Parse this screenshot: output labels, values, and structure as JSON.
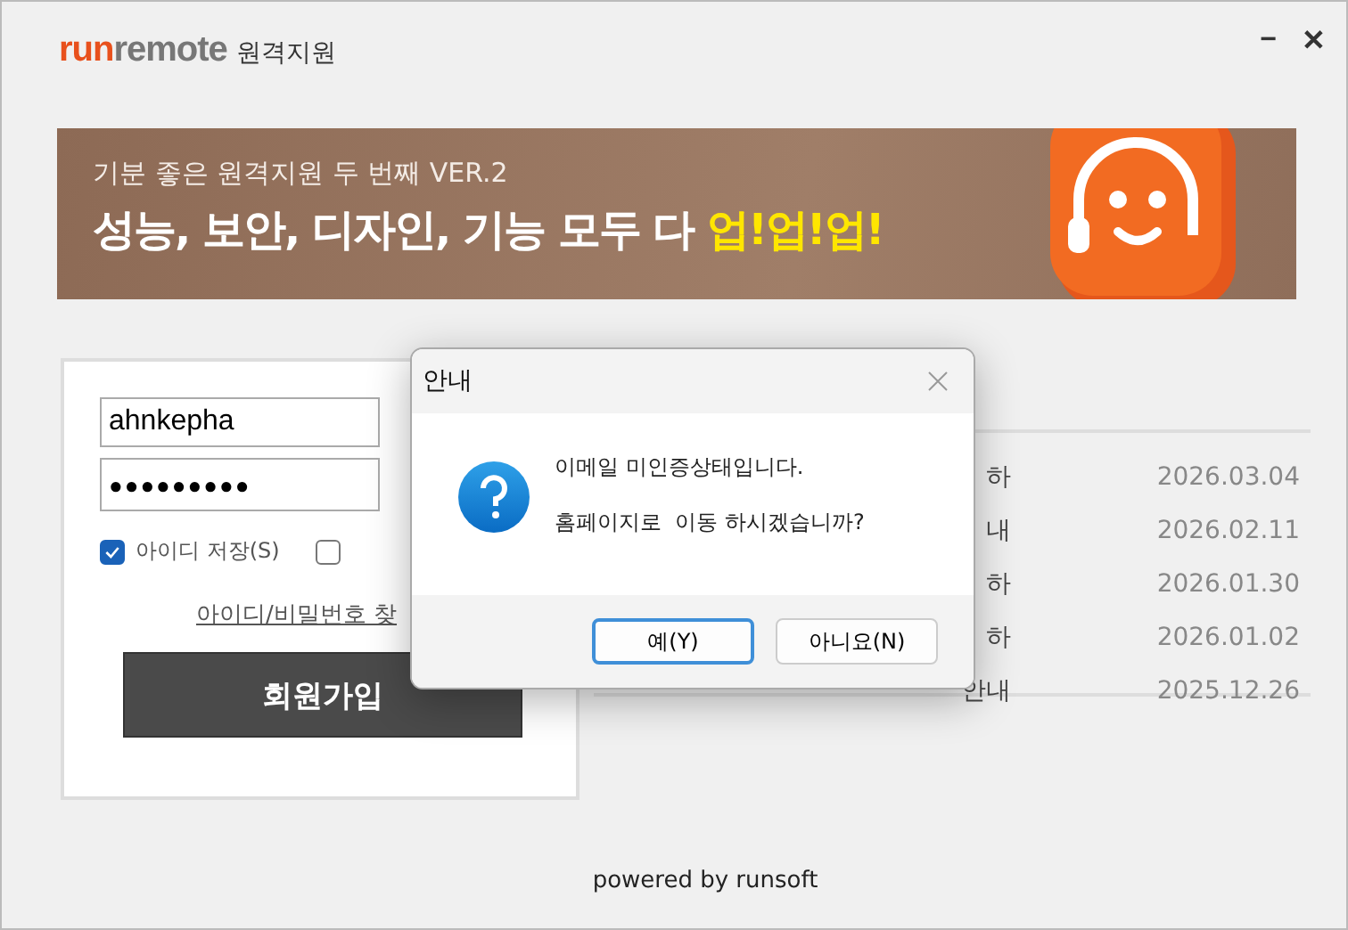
{
  "window": {
    "logo_brand_a": "run",
    "logo_brand_b": "remote",
    "logo_suffix": "원격지원",
    "minimize": "−",
    "close": "✕"
  },
  "banner": {
    "subtitle": "기분 좋은 원격지원 두 번째 VER.2",
    "headline": "성능, 보안, 디자인, 기능 모두 다 ",
    "highlight": "업!업!업!"
  },
  "login": {
    "username": "ahnkepha",
    "password": "●●●●●●●●●",
    "checkboxes": [
      {
        "label": "아이디 저장(S)",
        "checked": true
      },
      {
        "checked": false
      }
    ],
    "find_link": "아이디/비밀번호 찾",
    "signup_button": "회원가입"
  },
  "notices": [
    {
      "title": "하",
      "date": "2026.03.04"
    },
    {
      "title": "내",
      "date": "2026.02.11"
    },
    {
      "title": "하",
      "date": "2026.01.30"
    },
    {
      "title": "하",
      "date": "2026.01.02"
    },
    {
      "title": "안내",
      "date": "2025.12.26"
    }
  ],
  "footer": "powered by runsoft",
  "dialog": {
    "title": "안내",
    "message_lines": [
      "이메일 미인증상태입니다.",
      "홈페이지로  이동 하시겠습니까?"
    ],
    "buttons": [
      {
        "label": "예(Y)",
        "default": true
      },
      {
        "label": "아니요(N)",
        "default": false
      }
    ]
  }
}
